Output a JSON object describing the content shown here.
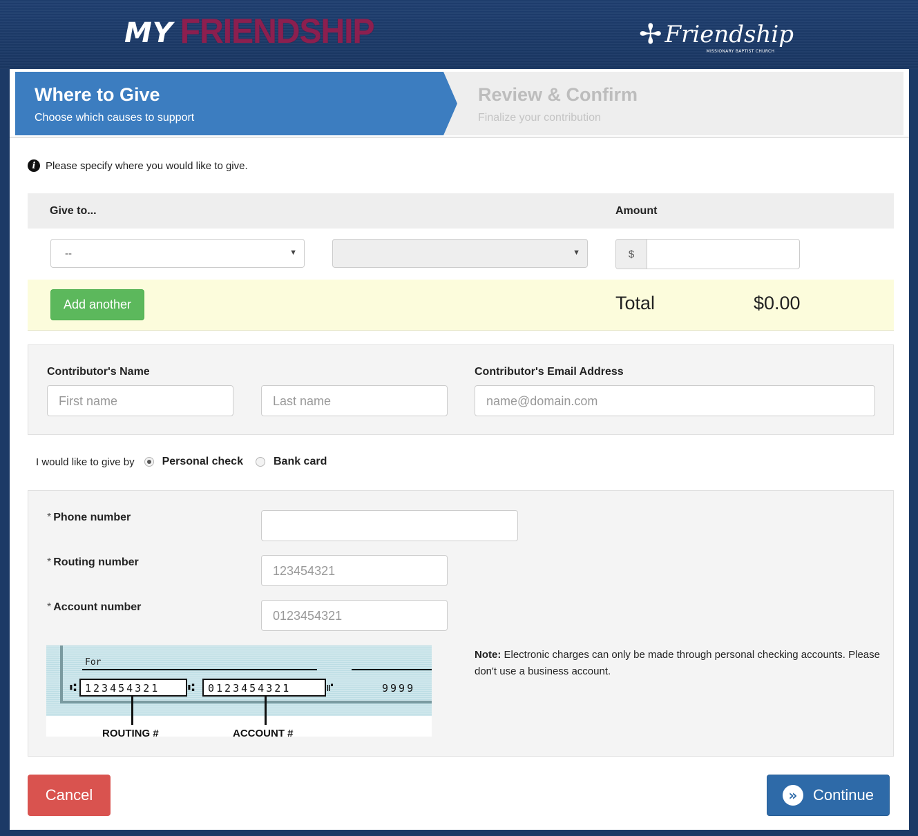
{
  "header": {
    "logo_left_my": "MY",
    "logo_left_brand": "FRIENDSHIP",
    "logo_right_script": "Friendship",
    "logo_right_sub": "MISSIONARY BAPTIST CHURCH"
  },
  "steps": [
    {
      "title": "Where to Give",
      "subtitle": "Choose which causes to support",
      "active": true
    },
    {
      "title": "Review & Confirm",
      "subtitle": "Finalize your contribution",
      "active": false
    }
  ],
  "info": {
    "text": "Please specify where you would like to give."
  },
  "give": {
    "col_give_to": "Give to...",
    "col_amount": "Amount",
    "fund_select_value": "--",
    "subfund_select_value": "",
    "currency": "$",
    "amount_value": "",
    "add_button": "Add another",
    "total_label": "Total",
    "total_value": "$0.00"
  },
  "contributor": {
    "name_label": "Contributor's Name",
    "first_placeholder": "First name",
    "last_placeholder": "Last name",
    "email_label": "Contributor's Email Address",
    "email_placeholder": "name@domain.com"
  },
  "payment": {
    "prompt": "I would like to give by",
    "options": [
      {
        "label": "Personal check",
        "selected": true
      },
      {
        "label": "Bank card",
        "selected": false
      }
    ]
  },
  "check": {
    "required_mark": "*",
    "phone_label": "Phone number",
    "phone_value": "",
    "routing_label": "Routing number",
    "routing_placeholder": "123454321",
    "account_label": "Account number",
    "account_placeholder": "0123454321",
    "note_bold": "Note:",
    "note_text": "Electronic charges can only be made through personal checking accounts. Please don't use a business account.",
    "image": {
      "for_label": "For",
      "routing_digits": "123454321",
      "account_digits": "0123454321",
      "check_no": "9999",
      "routing_caption": "ROUTING #",
      "account_caption": "ACCOUNT #"
    }
  },
  "footer": {
    "cancel": "Cancel",
    "continue": "Continue"
  }
}
